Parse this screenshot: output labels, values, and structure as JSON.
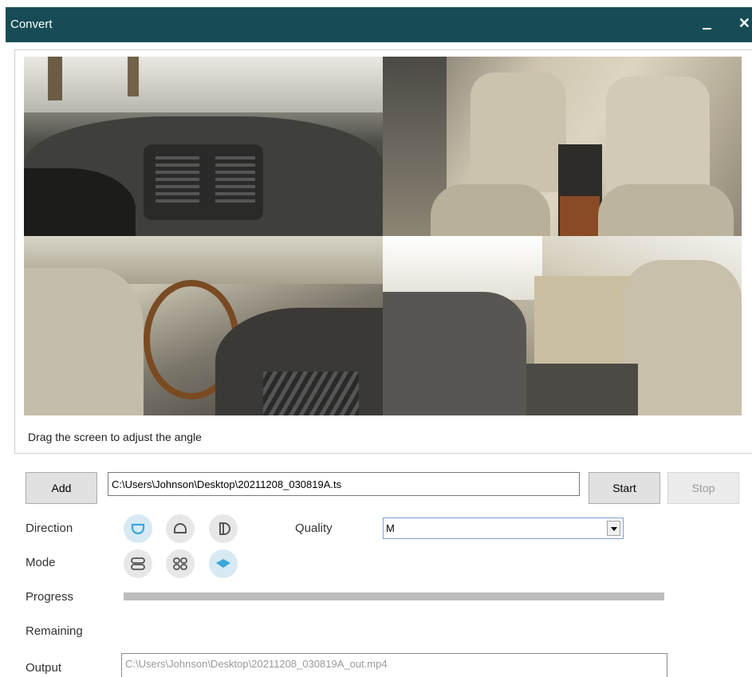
{
  "window": {
    "title": "Convert",
    "minimize_icon": "minimize-icon",
    "close_label": "✕"
  },
  "colors": {
    "titlebar": "#174b55",
    "accent": "#3aa7d8",
    "progress_fill": "#bdbdbd"
  },
  "preview": {
    "hint": "Drag the screen to adjust the angle"
  },
  "file": {
    "add_label": "Add",
    "path": "C:\\Users\\Johnson\\Desktop\\20211208_030819A.ts",
    "start_label": "Start",
    "stop_label": "Stop"
  },
  "direction": {
    "label": "Direction",
    "options": [
      "direction-bottom-icon",
      "direction-top-icon",
      "direction-side-icon"
    ],
    "selected": "direction-bottom-icon"
  },
  "quality": {
    "label": "Quality",
    "value": "M"
  },
  "mode": {
    "label": "Mode",
    "options": [
      "mode-dual-split-icon",
      "mode-quad-split-icon",
      "mode-flat-icon"
    ],
    "selected": "mode-flat-icon"
  },
  "progress": {
    "label": "Progress",
    "fraction": 1.0
  },
  "remaining": {
    "label": "Remaining"
  },
  "output": {
    "label": "Output",
    "path": "C:\\Users\\Johnson\\Desktop\\20211208_030819A_out.mp4"
  }
}
